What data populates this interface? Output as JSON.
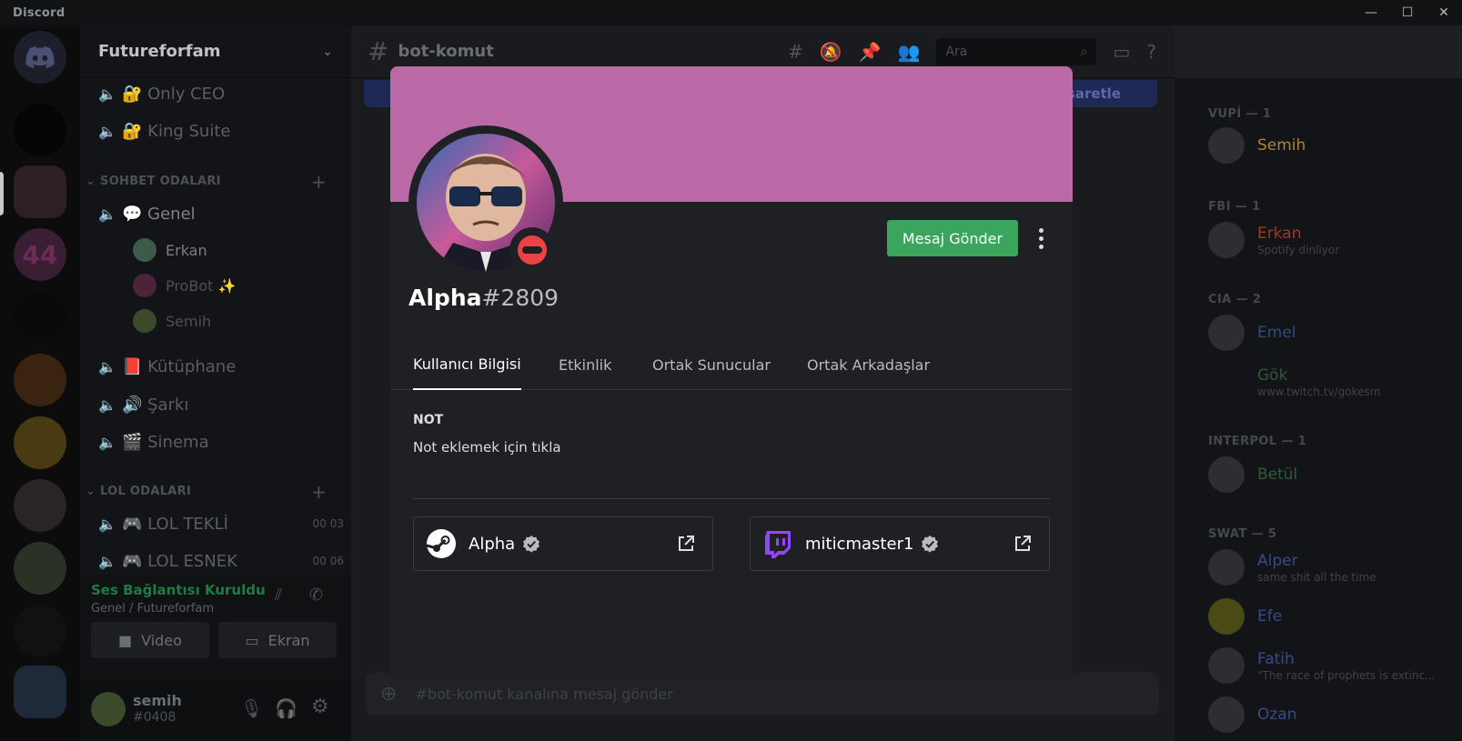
{
  "titlebar": {
    "app_name": "Discord",
    "minimize": "—",
    "maximize": "☐",
    "close": "✕"
  },
  "server": {
    "name": "Futureforfam",
    "channels_top": [
      {
        "icon": "speaker-icon",
        "label": "🔐 Only CEO"
      },
      {
        "icon": "speaker-icon",
        "label": "🔐 King Suite"
      }
    ],
    "category_1": "SOHBET ODALARI",
    "general_channel": "💬 Genel",
    "voice_members": [
      "Erkan",
      "ProBot ✨",
      "Semih"
    ],
    "channels_mid": [
      "📕 Kütüphane",
      "🔊 Şarkı",
      "🎬 Sinema"
    ],
    "category_2": "LOL ODALARI",
    "lol_channels": [
      {
        "label": "🎮 LOL TEKLİ",
        "a": "00",
        "b": "03"
      },
      {
        "label": "🎮 LOL ESNEK",
        "a": "00",
        "b": "06"
      }
    ],
    "voice_status": "Ses Bağlantısı Kuruldu",
    "voice_location": "Genel / Futureforfam",
    "video_label": "Video",
    "screen_label": "Ekran",
    "user": {
      "name": "semih",
      "tag": "#0408"
    }
  },
  "chat": {
    "channel_name": "bot-komut",
    "search_placeholder": "Ara",
    "input_placeholder": "#bot-komut kanalına mesaj gönder",
    "banner_text": "İşaretle"
  },
  "members": {
    "groups": [
      {
        "title": "VUPİ — 1",
        "members": [
          {
            "name": "Semih",
            "status": "",
            "color": "#a9843c"
          }
        ]
      },
      {
        "title": "FBI — 1",
        "members": [
          {
            "name": "Erkan",
            "status": "Spotify dinliyor",
            "color": "#9c3b28"
          }
        ]
      },
      {
        "title": "CIA — 2",
        "members": [
          {
            "name": "Emel",
            "status": "",
            "color": "#2c4e7a"
          },
          {
            "name": "Gök",
            "status": "www.twitch.tv/gokesm",
            "color": "#2e5a3c"
          }
        ]
      },
      {
        "title": "INTERPOL — 1",
        "members": [
          {
            "name": "Betül",
            "status": "",
            "color": "#2e5a3c"
          }
        ]
      },
      {
        "title": "SWAT — 5",
        "members": [
          {
            "name": "Alper",
            "status": "same shit all the time",
            "color": "#3a4a86"
          },
          {
            "name": "Efe",
            "status": "",
            "color": "#3a4a86"
          },
          {
            "name": "Fatih",
            "status": "\"The race of prophets is extinc...",
            "color": "#3a4a86"
          },
          {
            "name": "Ozan",
            "status": "",
            "color": "#3a4a86"
          }
        ]
      }
    ]
  },
  "profile": {
    "banner_color": "#bc6aa7",
    "name": "Alpha",
    "discriminator": "#2809",
    "status": "dnd",
    "message_button": "Mesaj Gönder",
    "tabs": [
      "Kullanıcı Bilgisi",
      "Etkinlik",
      "Ortak Sunucular",
      "Ortak Arkadaşlar"
    ],
    "active_tab": "Kullanıcı Bilgisi",
    "note_title": "NOT",
    "note_placeholder": "Not eklemek için tıkla",
    "connections": [
      {
        "platform": "steam",
        "icon": "steam-icon",
        "name": "Alpha",
        "verified": true
      },
      {
        "platform": "twitch",
        "icon": "twitch-icon",
        "name": "miticmaster1",
        "verified": true
      }
    ]
  }
}
